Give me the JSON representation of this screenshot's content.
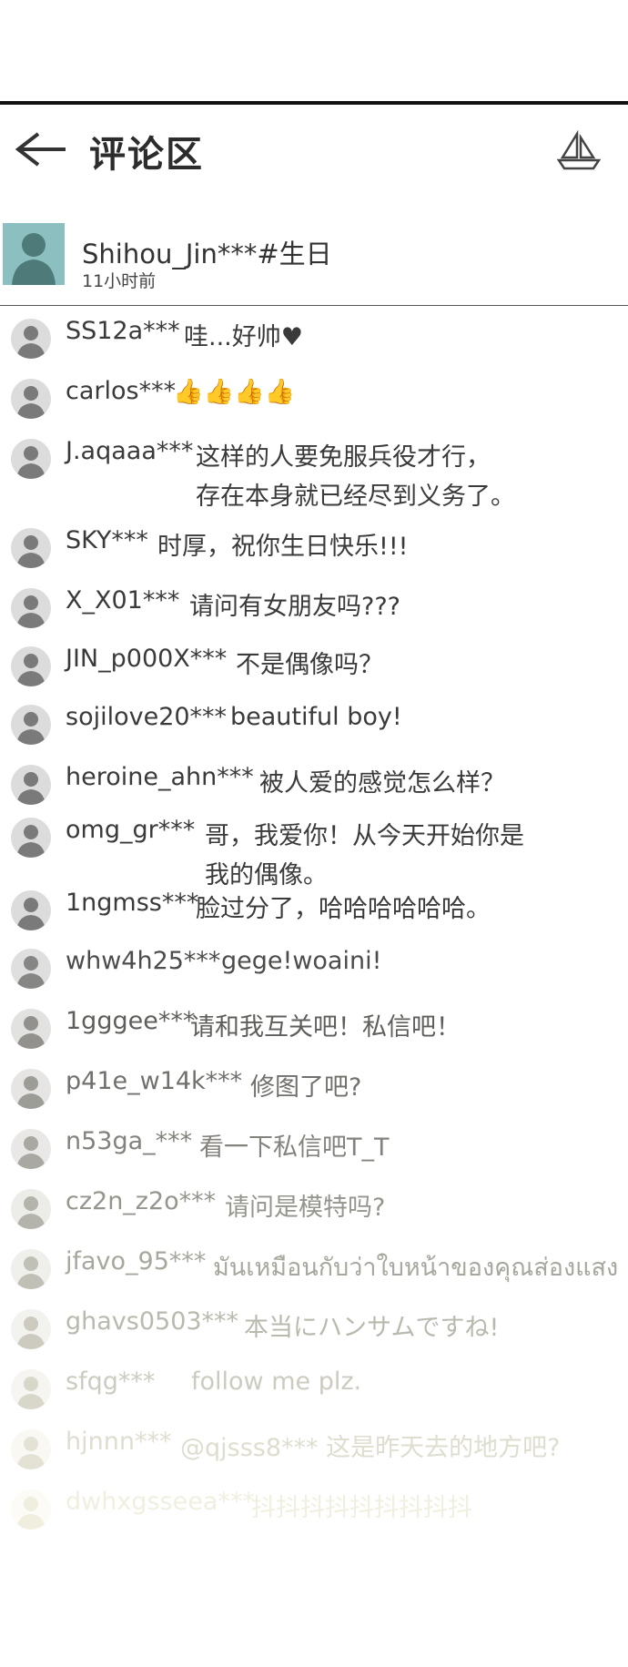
{
  "header": {
    "title": "评论区",
    "back_icon": "arrow-left-icon",
    "share_icon": "sailboat-icon"
  },
  "post": {
    "user": "Shihou_Jin***#生日",
    "time": "11小时前"
  },
  "comments": [
    {
      "user": "SS12a***",
      "text": "哇...好帅♥"
    },
    {
      "user": "carlos***",
      "text": "👍👍👍👍"
    },
    {
      "user": "J.aqaaa***",
      "text": "这样的人要免服兵役才行，",
      "text2": "存在本身就已经尽到义务了。"
    },
    {
      "user": "SKY***",
      "text": "时厚，祝你生日快乐!!!"
    },
    {
      "user": "X_X01***",
      "text": "请问有女朋友吗???"
    },
    {
      "user": "JIN_p000X***",
      "text": "不是偶像吗？"
    },
    {
      "user": "sojilove20***",
      "text": "beautiful boy!"
    },
    {
      "user": "heroine_ahn***",
      "text": "被人爱的感觉怎么样？"
    },
    {
      "user": "omg_gr***",
      "text": "哥，我爱你！从今天开始你是",
      "text2": "我的偶像。"
    },
    {
      "user": "1ngmss***",
      "text": "脸过分了，哈哈哈哈哈哈。"
    },
    {
      "user": "whw4h25***",
      "text": "gege!woaini!"
    },
    {
      "user": "1gggee***",
      "text": "请和我互关吧！私信吧！"
    },
    {
      "user": "p41e_w14k***",
      "text": "修图了吧?"
    },
    {
      "user": "n53ga_***",
      "text": "看一下私信吧T_T"
    },
    {
      "user": "cz2n_z2o***",
      "text": "请问是模特吗?"
    },
    {
      "user": "jfavo_95***",
      "text": "มันเหมือนกับว่าใบหน้าของคุณส่องแสง"
    },
    {
      "user": "ghavs0503***",
      "text": "本当にハンサムですね!"
    },
    {
      "user": "sfqg***",
      "text": "follow me plz."
    },
    {
      "user": "hjnnn***",
      "text": "@qjsss8*** 这是昨天去的地方吧?"
    },
    {
      "user": "dwhxgsseea***",
      "text": "抖抖抖抖抖抖抖抖抖"
    }
  ],
  "colors": {
    "rule": "#111111",
    "fade_start": "#3a3a3a",
    "fade_end": "#f0efe0"
  }
}
